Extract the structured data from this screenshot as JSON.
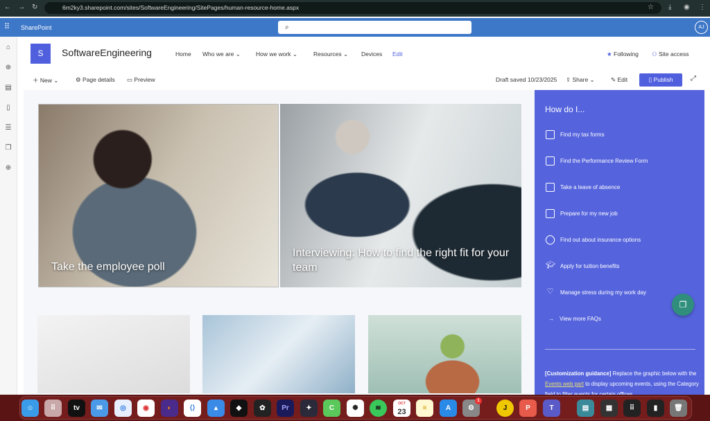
{
  "browser": {
    "url": "6m2ky3.sharepoint.com/sites/SoftwareEngineering/SitePages/human-resource-home.aspx"
  },
  "suite": {
    "app_name": "SharePoint",
    "avatar": "AJ"
  },
  "site": {
    "logo_letter": "S",
    "title": "SoftwareEngineering",
    "nav": [
      "Home",
      "Who we are",
      "How we work",
      "Resources",
      "Devices",
      "Edit"
    ],
    "following": "Following",
    "site_access": "Site access"
  },
  "commands": {
    "new": "New",
    "page_details": "Page details",
    "preview": "Preview",
    "draft": "Draft saved 10/23/2025",
    "share": "Share",
    "edit": "Edit",
    "publish": "Publish"
  },
  "hero": [
    {
      "caption": "Take the employee poll"
    },
    {
      "caption": "Interviewing: How to find the right fit for your team"
    }
  ],
  "panel": {
    "title": "How do I...",
    "items": [
      {
        "label": "Find my tax forms",
        "icon": "folder-icon"
      },
      {
        "label": "Find the Performance Review Form",
        "icon": "clipboard-icon"
      },
      {
        "label": "Take a leave of absence",
        "icon": "exit-icon"
      },
      {
        "label": "Prepare for my new job",
        "icon": "people-icon"
      },
      {
        "label": "Find out about insurance options",
        "icon": "pill-icon"
      },
      {
        "label": "Apply for tuition benefits",
        "icon": "mortarboard-icon"
      },
      {
        "label": "Manage stress during my work day",
        "icon": "heart-pulse-icon"
      }
    ],
    "more": "View more FAQs",
    "guidance_bold": "[Customization guidance]",
    "guidance_1": " Replace the graphic below with the ",
    "guidance_link": "Events web part",
    "guidance_2": " to display upcoming events, using the Category field to filter events for certain offices"
  },
  "dock": {
    "calendar_month": "OCT",
    "calendar_day": "23",
    "badge": "1"
  },
  "colors": {
    "accent": "#4f5fde",
    "panel": "#5564dd",
    "suite": "#3d77c8"
  }
}
